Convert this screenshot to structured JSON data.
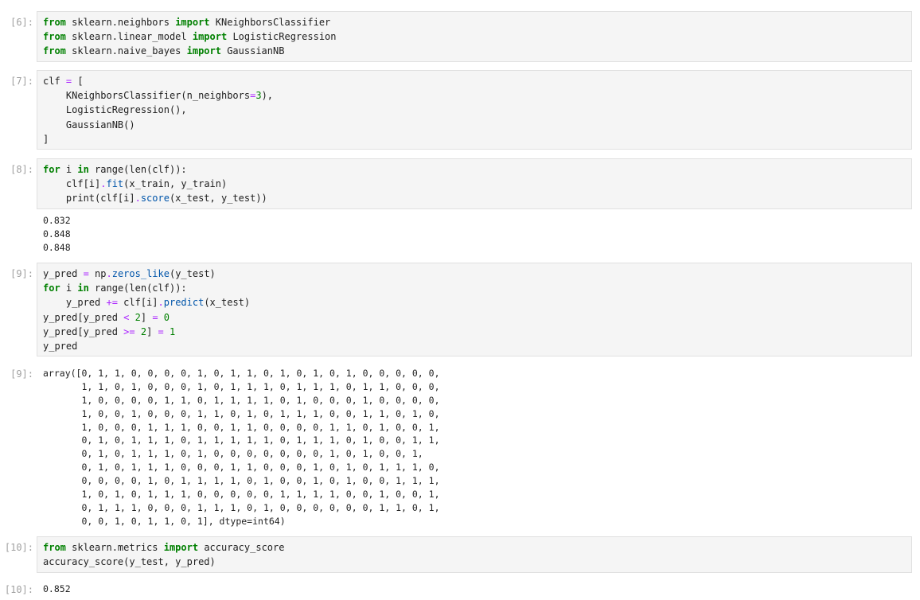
{
  "cells": [
    {
      "id": "c6",
      "in_prompt": "[6]:",
      "lines": [
        [
          {
            "t": "from",
            "c": "kw"
          },
          {
            "t": " sklearn.neighbors ",
            "c": ""
          },
          {
            "t": "import",
            "c": "kw"
          },
          {
            "t": " KNeighborsClassifier",
            "c": ""
          }
        ],
        [
          {
            "t": "from",
            "c": "kw"
          },
          {
            "t": " sklearn.linear_model ",
            "c": ""
          },
          {
            "t": "import",
            "c": "kw"
          },
          {
            "t": " LogisticRegression",
            "c": ""
          }
        ],
        [
          {
            "t": "from",
            "c": "kw"
          },
          {
            "t": " sklearn.naive_bayes ",
            "c": ""
          },
          {
            "t": "import",
            "c": "kw"
          },
          {
            "t": " GaussianNB",
            "c": ""
          }
        ]
      ]
    },
    {
      "id": "c7",
      "in_prompt": "[7]:",
      "lines": [
        [
          {
            "t": "clf ",
            "c": ""
          },
          {
            "t": "=",
            "c": "op"
          },
          {
            "t": " [",
            "c": ""
          }
        ],
        [
          {
            "t": "    KNeighborsClassifier(n_neighbors",
            "c": ""
          },
          {
            "t": "=",
            "c": "op"
          },
          {
            "t": "3",
            "c": "num"
          },
          {
            "t": "),",
            "c": ""
          }
        ],
        [
          {
            "t": "    LogisticRegression(),",
            "c": ""
          }
        ],
        [
          {
            "t": "    GaussianNB()",
            "c": ""
          }
        ],
        [
          {
            "t": "]",
            "c": ""
          }
        ]
      ]
    },
    {
      "id": "c8",
      "in_prompt": "[8]:",
      "lines": [
        [
          {
            "t": "for",
            "c": "kw"
          },
          {
            "t": " i ",
            "c": ""
          },
          {
            "t": "in",
            "c": "kw"
          },
          {
            "t": " range(len(clf)):",
            "c": ""
          }
        ],
        [
          {
            "t": "    clf[i]",
            "c": ""
          },
          {
            "t": ".",
            "c": "op"
          },
          {
            "t": "fit",
            "c": "fn"
          },
          {
            "t": "(x_train, y_train)",
            "c": ""
          }
        ],
        [
          {
            "t": "    print(clf[i]",
            "c": ""
          },
          {
            "t": ".",
            "c": "op"
          },
          {
            "t": "score",
            "c": "fn"
          },
          {
            "t": "(x_test, y_test))",
            "c": ""
          }
        ]
      ],
      "output": [
        "0.832",
        "0.848",
        "0.848"
      ]
    },
    {
      "id": "c9",
      "in_prompt": "[9]:",
      "lines": [
        [
          {
            "t": "y_pred ",
            "c": ""
          },
          {
            "t": "=",
            "c": "op"
          },
          {
            "t": " np",
            "c": ""
          },
          {
            "t": ".",
            "c": "op"
          },
          {
            "t": "zeros_like",
            "c": "fn"
          },
          {
            "t": "(y_test)",
            "c": ""
          }
        ],
        [
          {
            "t": "for",
            "c": "kw"
          },
          {
            "t": " i ",
            "c": ""
          },
          {
            "t": "in",
            "c": "kw"
          },
          {
            "t": " range(len(clf)):",
            "c": ""
          }
        ],
        [
          {
            "t": "    y_pred ",
            "c": ""
          },
          {
            "t": "+=",
            "c": "op"
          },
          {
            "t": " clf[i]",
            "c": ""
          },
          {
            "t": ".",
            "c": "op"
          },
          {
            "t": "predict",
            "c": "fn"
          },
          {
            "t": "(x_test)",
            "c": ""
          }
        ],
        [
          {
            "t": "y_pred[y_pred ",
            "c": ""
          },
          {
            "t": "<",
            "c": "op"
          },
          {
            "t": " ",
            "c": ""
          },
          {
            "t": "2",
            "c": "num"
          },
          {
            "t": "] ",
            "c": ""
          },
          {
            "t": "=",
            "c": "op"
          },
          {
            "t": " ",
            "c": ""
          },
          {
            "t": "0",
            "c": "num"
          }
        ],
        [
          {
            "t": "y_pred[y_pred ",
            "c": ""
          },
          {
            "t": ">=",
            "c": "op"
          },
          {
            "t": " ",
            "c": ""
          },
          {
            "t": "2",
            "c": "num"
          },
          {
            "t": "] ",
            "c": ""
          },
          {
            "t": "=",
            "c": "op"
          },
          {
            "t": " ",
            "c": ""
          },
          {
            "t": "1",
            "c": "num"
          }
        ],
        [
          {
            "t": "y_pred",
            "c": ""
          }
        ]
      ],
      "out_prompt": "[9]:",
      "output": [
        "array([0, 1, 1, 0, 0, 0, 0, 1, 0, 1, 1, 0, 1, 0, 1, 0, 1, 0, 0, 0, 0, 0,",
        "       1, 1, 0, 1, 0, 0, 0, 1, 0, 1, 1, 1, 0, 1, 1, 1, 0, 1, 1, 0, 0, 0,",
        "       1, 0, 0, 0, 0, 1, 1, 0, 1, 1, 1, 1, 0, 1, 0, 0, 0, 1, 0, 0, 0, 0,",
        "       1, 0, 0, 1, 0, 0, 0, 1, 1, 0, 1, 0, 1, 1, 1, 0, 0, 1, 1, 0, 1, 0,",
        "       1, 0, 0, 0, 1, 1, 1, 0, 0, 1, 1, 0, 0, 0, 0, 1, 1, 0, 1, 0, 0, 1,",
        "       0, 1, 0, 1, 1, 1, 0, 1, 1, 1, 1, 1, 0, 1, 1, 1, 0, 1, 0, 0, 1, 1,",
        "       0, 1, 0, 1, 1, 1, 0, 1, 0, 0, 0, 0, 0, 0, 0, 1, 0, 1, 0, 0, 1,",
        "       0, 1, 0, 1, 1, 1, 0, 0, 0, 1, 1, 0, 0, 0, 1, 0, 1, 0, 1, 1, 1, 0,",
        "       0, 0, 0, 0, 1, 0, 1, 1, 1, 1, 0, 1, 0, 0, 1, 0, 1, 0, 0, 1, 1, 1,",
        "       1, 0, 1, 0, 1, 1, 1, 0, 0, 0, 0, 0, 1, 1, 1, 1, 0, 0, 1, 0, 0, 1,",
        "       0, 1, 1, 1, 0, 0, 0, 1, 1, 1, 0, 1, 0, 0, 0, 0, 0, 0, 1, 1, 0, 1,",
        "       0, 0, 1, 0, 1, 1, 0, 1], dtype=int64)"
      ]
    },
    {
      "id": "c10",
      "in_prompt": "[10]:",
      "lines": [
        [
          {
            "t": "from",
            "c": "kw"
          },
          {
            "t": " sklearn.metrics ",
            "c": ""
          },
          {
            "t": "import",
            "c": "kw"
          },
          {
            "t": " accuracy_score",
            "c": ""
          }
        ],
        [
          {
            "t": "accuracy_score(y_test, y_pred)",
            "c": ""
          }
        ]
      ],
      "out_prompt": "[10]:",
      "output": [
        "0.852"
      ]
    }
  ]
}
